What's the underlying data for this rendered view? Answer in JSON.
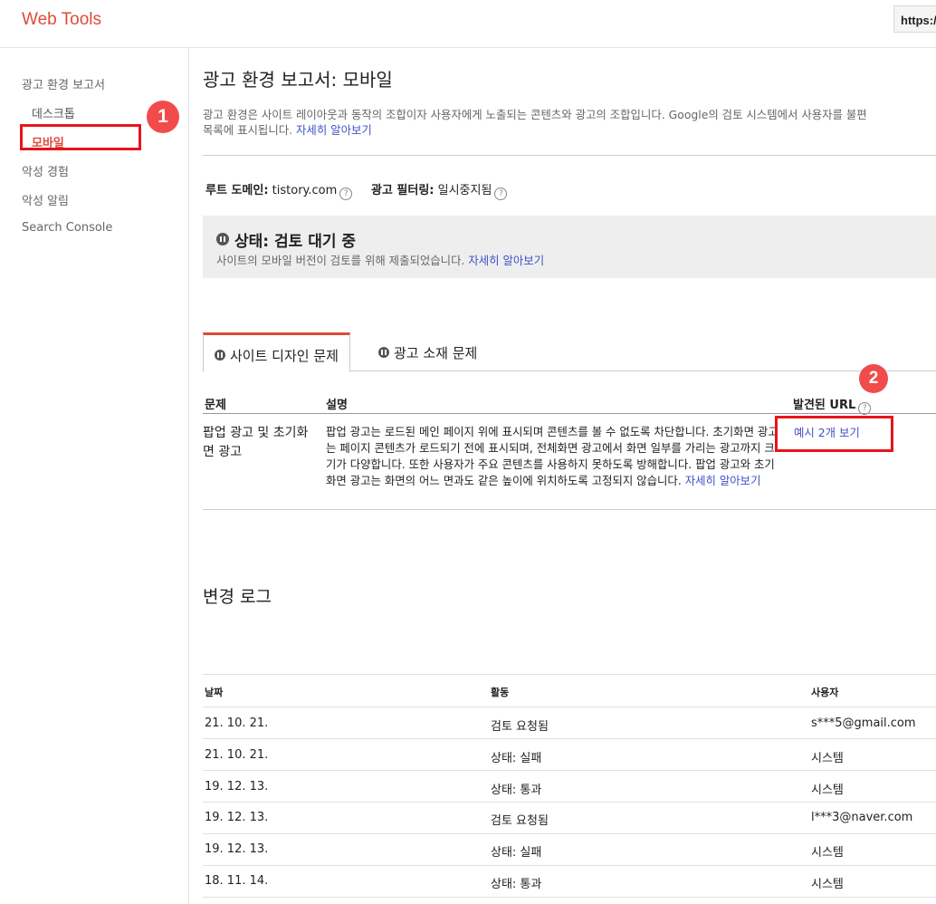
{
  "app": {
    "brand": "Web Tools",
    "url_partial": "https:/"
  },
  "sidebar": {
    "items": [
      {
        "label": "광고 환경 보고서"
      },
      {
        "label": "데스크톱"
      },
      {
        "label": "모바일"
      },
      {
        "label": "악성 경험"
      },
      {
        "label": "악성 알림"
      },
      {
        "label": "Search Console"
      }
    ]
  },
  "annotations": {
    "badge1": "1",
    "badge2": "2"
  },
  "page": {
    "title": "광고 환경 보고서: 모바일",
    "intro_line1": "광고 환경은 사이트 레이아웃과 동작의 조합이자 사용자에게 노출되는 콘텐츠와 광고의 조합입니다. Google의 검토 시스템에서 사용자를 불편",
    "intro_line2": "목록에 표시됩니다.",
    "intro_link": "자세히 알아보기",
    "root_domain_label": "루트 도메인:",
    "root_domain_value": "tistory.com",
    "ad_filter_label": "광고 필터링:",
    "ad_filter_value": "일시중지됨",
    "help_glyph": "?"
  },
  "status": {
    "title": "상태: 검토 대기 중",
    "desc": "사이트의 모바일 버전이 검토를 위해 제출되었습니다.",
    "link": "자세히 알아보기"
  },
  "tabs": [
    {
      "label": "사이트 디자인 문제"
    },
    {
      "label": "광고 소재 문제"
    }
  ],
  "issues_table": {
    "headers": {
      "issue": "문제",
      "desc": "설명",
      "urls": "발견된 URL"
    },
    "row": {
      "issue": "팝업 광고 및 초기화면 광고",
      "desc": "팝업 광고는 로드된 메인 페이지 위에 표시되며 콘텐츠를 볼 수 없도록 차단합니다. 초기화면 광고는 페이지 콘텐츠가 로드되기 전에 표시되며, 전체화면 광고에서 화면 일부를 가리는 광고까지 크기가 다양합니다. 또한 사용자가 주요 콘텐츠를 사용하지 못하도록 방해합니다. 팝업 광고와 초기화면 광고는 화면의 어느 면과도 같은 높이에 위치하도록 고정되지 않습니다.",
      "desc_link": "자세히 알아보기",
      "url_link": "예시 2개 보기"
    }
  },
  "change_log": {
    "title": "변경 로그",
    "headers": {
      "date": "날짜",
      "activity": "활동",
      "user": "사용자"
    },
    "rows": [
      {
        "date": "21. 10. 21.",
        "activity": "검토 요청됨",
        "user": "s***5@gmail.com"
      },
      {
        "date": "21. 10. 21.",
        "activity": "상태: 실패",
        "user": "시스템"
      },
      {
        "date": "19. 12. 13.",
        "activity": "상태: 통과",
        "user": "시스템"
      },
      {
        "date": "19. 12. 13.",
        "activity": "검토 요청됨",
        "user": "l***3@naver.com"
      },
      {
        "date": "19. 12. 13.",
        "activity": "상태: 실패",
        "user": "시스템"
      },
      {
        "date": "18. 11. 14.",
        "activity": "상태: 통과",
        "user": "시스템"
      }
    ]
  },
  "colors": {
    "brand_red": "#dd4b39",
    "link": "#3f51c8",
    "highlight": "#e8141b",
    "badge": "#f14b4b"
  }
}
